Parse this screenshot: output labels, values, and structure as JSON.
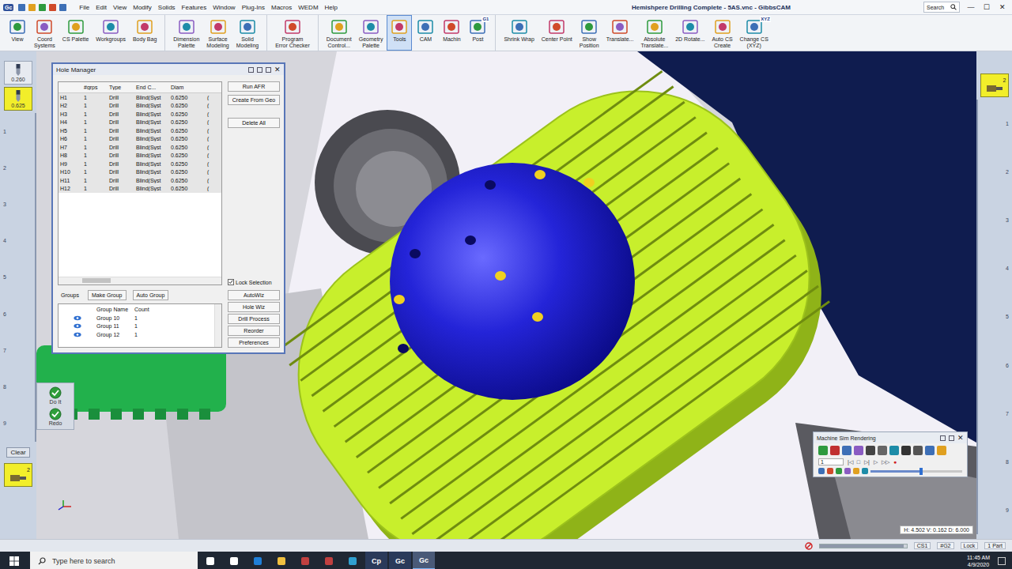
{
  "window": {
    "title": "Hemishpere Drilling Complete - 5AS.vnc - GibbsCAM",
    "app_badge": "Gc",
    "search_placeholder": "Search",
    "controls": [
      "—",
      "☐",
      "✕"
    ]
  },
  "menu": [
    "File",
    "Edit",
    "View",
    "Modify",
    "Solids",
    "Features",
    "Window",
    "Plug-Ins",
    "Macros",
    "WEDM",
    "Help"
  ],
  "toolbar": [
    {
      "items": [
        {
          "lines": [
            "View"
          ],
          "selected": false
        },
        {
          "lines": [
            "Coord",
            "Systems"
          ],
          "selected": false
        },
        {
          "lines": [
            "CS Palette"
          ],
          "selected": false
        },
        {
          "lines": [
            "Workgroups"
          ],
          "selected": false
        },
        {
          "lines": [
            "Body Bag"
          ],
          "selected": false
        }
      ]
    },
    {
      "items": [
        {
          "lines": [
            "Dimension",
            "Palette"
          ],
          "selected": false
        },
        {
          "lines": [
            "Surface",
            "Modeling"
          ],
          "selected": false
        },
        {
          "lines": [
            "Solid",
            "Modeling"
          ],
          "selected": false
        }
      ]
    },
    {
      "items": [
        {
          "lines": [
            "Program",
            "Error Checker"
          ],
          "selected": false
        }
      ]
    },
    {
      "items": [
        {
          "lines": [
            "Document",
            "Control..."
          ],
          "selected": false
        },
        {
          "lines": [
            "Geometry",
            "Palette"
          ],
          "selected": false
        },
        {
          "lines": [
            "Tools"
          ],
          "selected": true
        },
        {
          "lines": [
            "CAM"
          ],
          "selected": false
        },
        {
          "lines": [
            "Machin"
          ],
          "selected": false
        },
        {
          "lines": [
            "Post"
          ],
          "selected": false,
          "badge": "G1"
        }
      ]
    },
    {
      "items": [
        {
          "lines": [
            "Shrink Wrap"
          ],
          "selected": false
        },
        {
          "lines": [
            "Center Point"
          ],
          "selected": false
        },
        {
          "lines": [
            "Show",
            "Position"
          ],
          "selected": false
        },
        {
          "lines": [
            "Translate..."
          ],
          "selected": false
        },
        {
          "lines": [
            "Absolute",
            "Translate..."
          ],
          "selected": false
        },
        {
          "lines": [
            "2D Rotate..."
          ],
          "selected": false
        },
        {
          "lines": [
            "Auto CS",
            "Create"
          ],
          "selected": false
        },
        {
          "lines": [
            "Change CS",
            "(XYZ)"
          ],
          "selected": false,
          "badge": "XYZ"
        }
      ]
    }
  ],
  "left_strip": {
    "tools": [
      {
        "size": "0.260",
        "selected": false
      },
      {
        "size": "0.625",
        "selected": true
      }
    ],
    "ruler": [
      "1",
      "2",
      "3",
      "4",
      "5",
      "6",
      "7",
      "8",
      "9"
    ],
    "clear": "Clear",
    "current_tool": "2"
  },
  "actions": [
    {
      "label": "Do It"
    },
    {
      "label": "Redo"
    }
  ],
  "right_strip": {
    "current_tool": "2",
    "ruler": [
      "1",
      "2",
      "3",
      "4",
      "5",
      "6",
      "7",
      "8",
      "9"
    ]
  },
  "viewport": {
    "readout": "H: 4.502 V: 0.162 D: 6.000"
  },
  "hole_manager": {
    "title": "Hole Manager",
    "close": "✕",
    "columns": [
      "",
      "#grps",
      "Type",
      "End C...",
      "Diam",
      ""
    ],
    "rows": [
      {
        "cells": [
          "H1",
          "1",
          "Drill",
          "Blind(Syst",
          "0.6250",
          "("
        ],
        "selected": true
      },
      {
        "cells": [
          "H2",
          "1",
          "Drill",
          "Blind(Syst",
          "0.6250",
          "("
        ],
        "selected": true
      },
      {
        "cells": [
          "H3",
          "1",
          "Drill",
          "Blind(Syst",
          "0.6250",
          "("
        ],
        "selected": true
      },
      {
        "cells": [
          "H4",
          "1",
          "Drill",
          "Blind(Syst",
          "0.6250",
          "("
        ],
        "selected": true
      },
      {
        "cells": [
          "H5",
          "1",
          "Drill",
          "Blind(Syst",
          "0.6250",
          "("
        ],
        "selected": true
      },
      {
        "cells": [
          "H6",
          "1",
          "Drill",
          "Blind(Syst",
          "0.6250",
          "("
        ],
        "selected": true
      },
      {
        "cells": [
          "H7",
          "1",
          "Drill",
          "Blind(Syst",
          "0.6250",
          "("
        ],
        "selected": true
      },
      {
        "cells": [
          "H8",
          "1",
          "Drill",
          "Blind(Syst",
          "0.6250",
          "("
        ],
        "selected": true
      },
      {
        "cells": [
          "H9",
          "1",
          "Drill",
          "Blind(Syst",
          "0.6250",
          "("
        ],
        "selected": true
      },
      {
        "cells": [
          "H10",
          "1",
          "Drill",
          "Blind(Syst",
          "0.6250",
          "("
        ],
        "selected": true
      },
      {
        "cells": [
          "H11",
          "1",
          "Drill",
          "Blind(Syst",
          "0.6250",
          "("
        ],
        "selected": true
      },
      {
        "cells": [
          "H12",
          "1",
          "Drill",
          "Blind(Syst",
          "0.6250",
          "("
        ],
        "selected": true
      }
    ],
    "buttons": [
      "Run AFR",
      "Create From Geo",
      "Delete All"
    ],
    "lock_selection": {
      "label": "Lock Selection",
      "checked": true
    },
    "groups_label": "Groups",
    "group_buttons": [
      "Make Group",
      "Auto Group"
    ],
    "group_columns": [
      "Group Name",
      "Count"
    ],
    "groups": [
      {
        "name": "Group 10",
        "count": "1",
        "visible": true
      },
      {
        "name": "Group 11",
        "count": "1",
        "visible": true
      },
      {
        "name": "Group 12",
        "count": "1",
        "visible": true
      }
    ],
    "wizard_buttons": [
      "AutoWiz",
      "Hole Wiz",
      "Drill Process",
      "Reorder",
      "Preferences"
    ]
  },
  "machine_sim": {
    "title": "Machine Sim Rendering",
    "close": "✕",
    "frame": "1",
    "controls": [
      "|◁",
      "□",
      "▷|",
      "▷",
      "▷▷",
      "●"
    ],
    "level": 0.55
  },
  "status_bar": {
    "level": 0.97,
    "items": [
      "CS1",
      "#G2",
      "Lock",
      "1 Part"
    ]
  },
  "taskbar": {
    "search_placeholder": "Type here to search",
    "apps": [
      {
        "label": "Cp",
        "active": false
      },
      {
        "label": "Gc",
        "active": false
      },
      {
        "label": "Gc",
        "active": true
      }
    ],
    "time": "11:45 AM",
    "date": "4/9/2020"
  }
}
